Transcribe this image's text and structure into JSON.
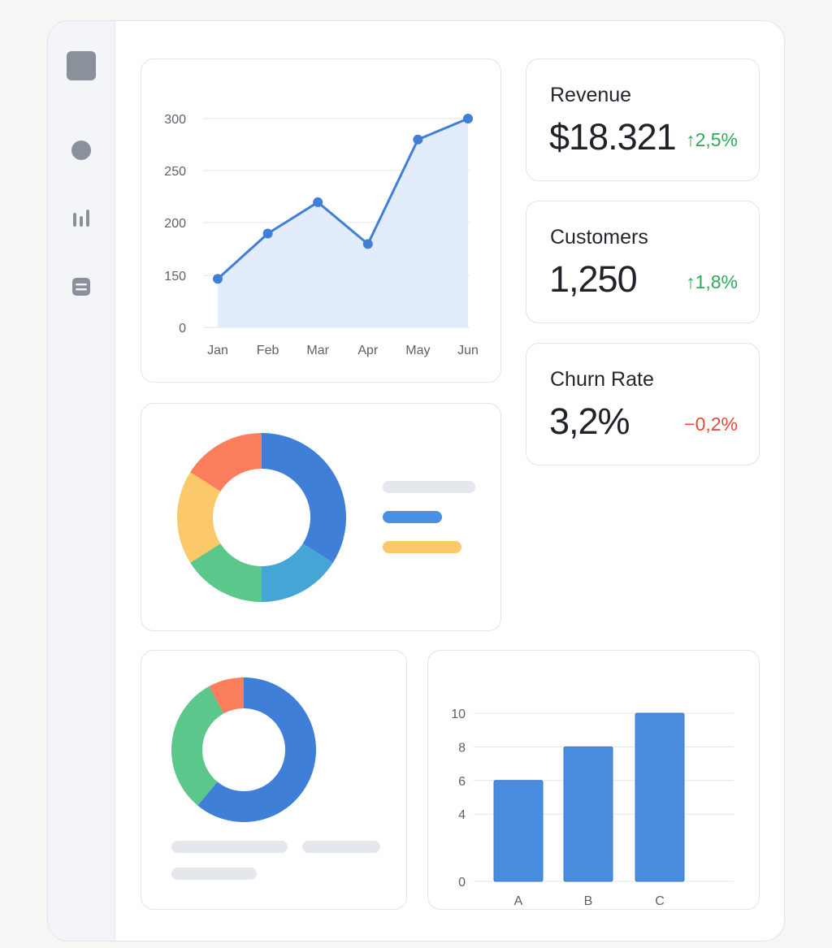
{
  "sidebar": {
    "items": [
      {
        "icon": "square-icon"
      },
      {
        "icon": "circle-icon"
      },
      {
        "icon": "bar-chart-icon"
      },
      {
        "icon": "list-icon"
      }
    ]
  },
  "stats": [
    {
      "title": "Revenue",
      "value": "$18.321",
      "change": "↑2,5%",
      "trend": "up"
    },
    {
      "title": "Customers",
      "value": "1,250",
      "change": "↑1,8%",
      "trend": "up"
    },
    {
      "title": "Churn Rate",
      "value": "3,2%",
      "change": "−0,2%",
      "trend": "down"
    }
  ],
  "colors": {
    "primary": "#3f7fd8",
    "teal": "#45a6d6",
    "green": "#5cc78a",
    "yellow": "#fcc96a",
    "red": "#fa7d5c",
    "up": "#2faa5a",
    "down": "#e54a3a"
  },
  "chart_data": [
    {
      "type": "area",
      "categories": [
        "Jan",
        "Feb",
        "Mar",
        "Apr",
        "May",
        "Jun"
      ],
      "values": [
        140,
        190,
        220,
        180,
        280,
        300
      ],
      "y_ticks": [
        "0",
        "150",
        "200",
        "250",
        "300"
      ],
      "grid": true
    },
    {
      "type": "pie",
      "variant": "donut",
      "values": [
        34,
        16,
        16,
        18,
        16
      ],
      "colors": [
        "#3f7fd8",
        "#45a6d6",
        "#5cc78a",
        "#fcc96a",
        "#fa7d5c"
      ]
    },
    {
      "type": "pie",
      "variant": "donut",
      "values": [
        61,
        31,
        8
      ],
      "colors": [
        "#3f7fd8",
        "#5cc78a",
        "#fa7d5c"
      ]
    },
    {
      "type": "bar",
      "categories": [
        "A",
        "B",
        "C"
      ],
      "values": [
        6,
        8,
        10
      ],
      "ylim": [
        0,
        10
      ],
      "y_ticks": [
        0,
        4,
        6,
        8,
        10
      ],
      "grid": true
    }
  ]
}
